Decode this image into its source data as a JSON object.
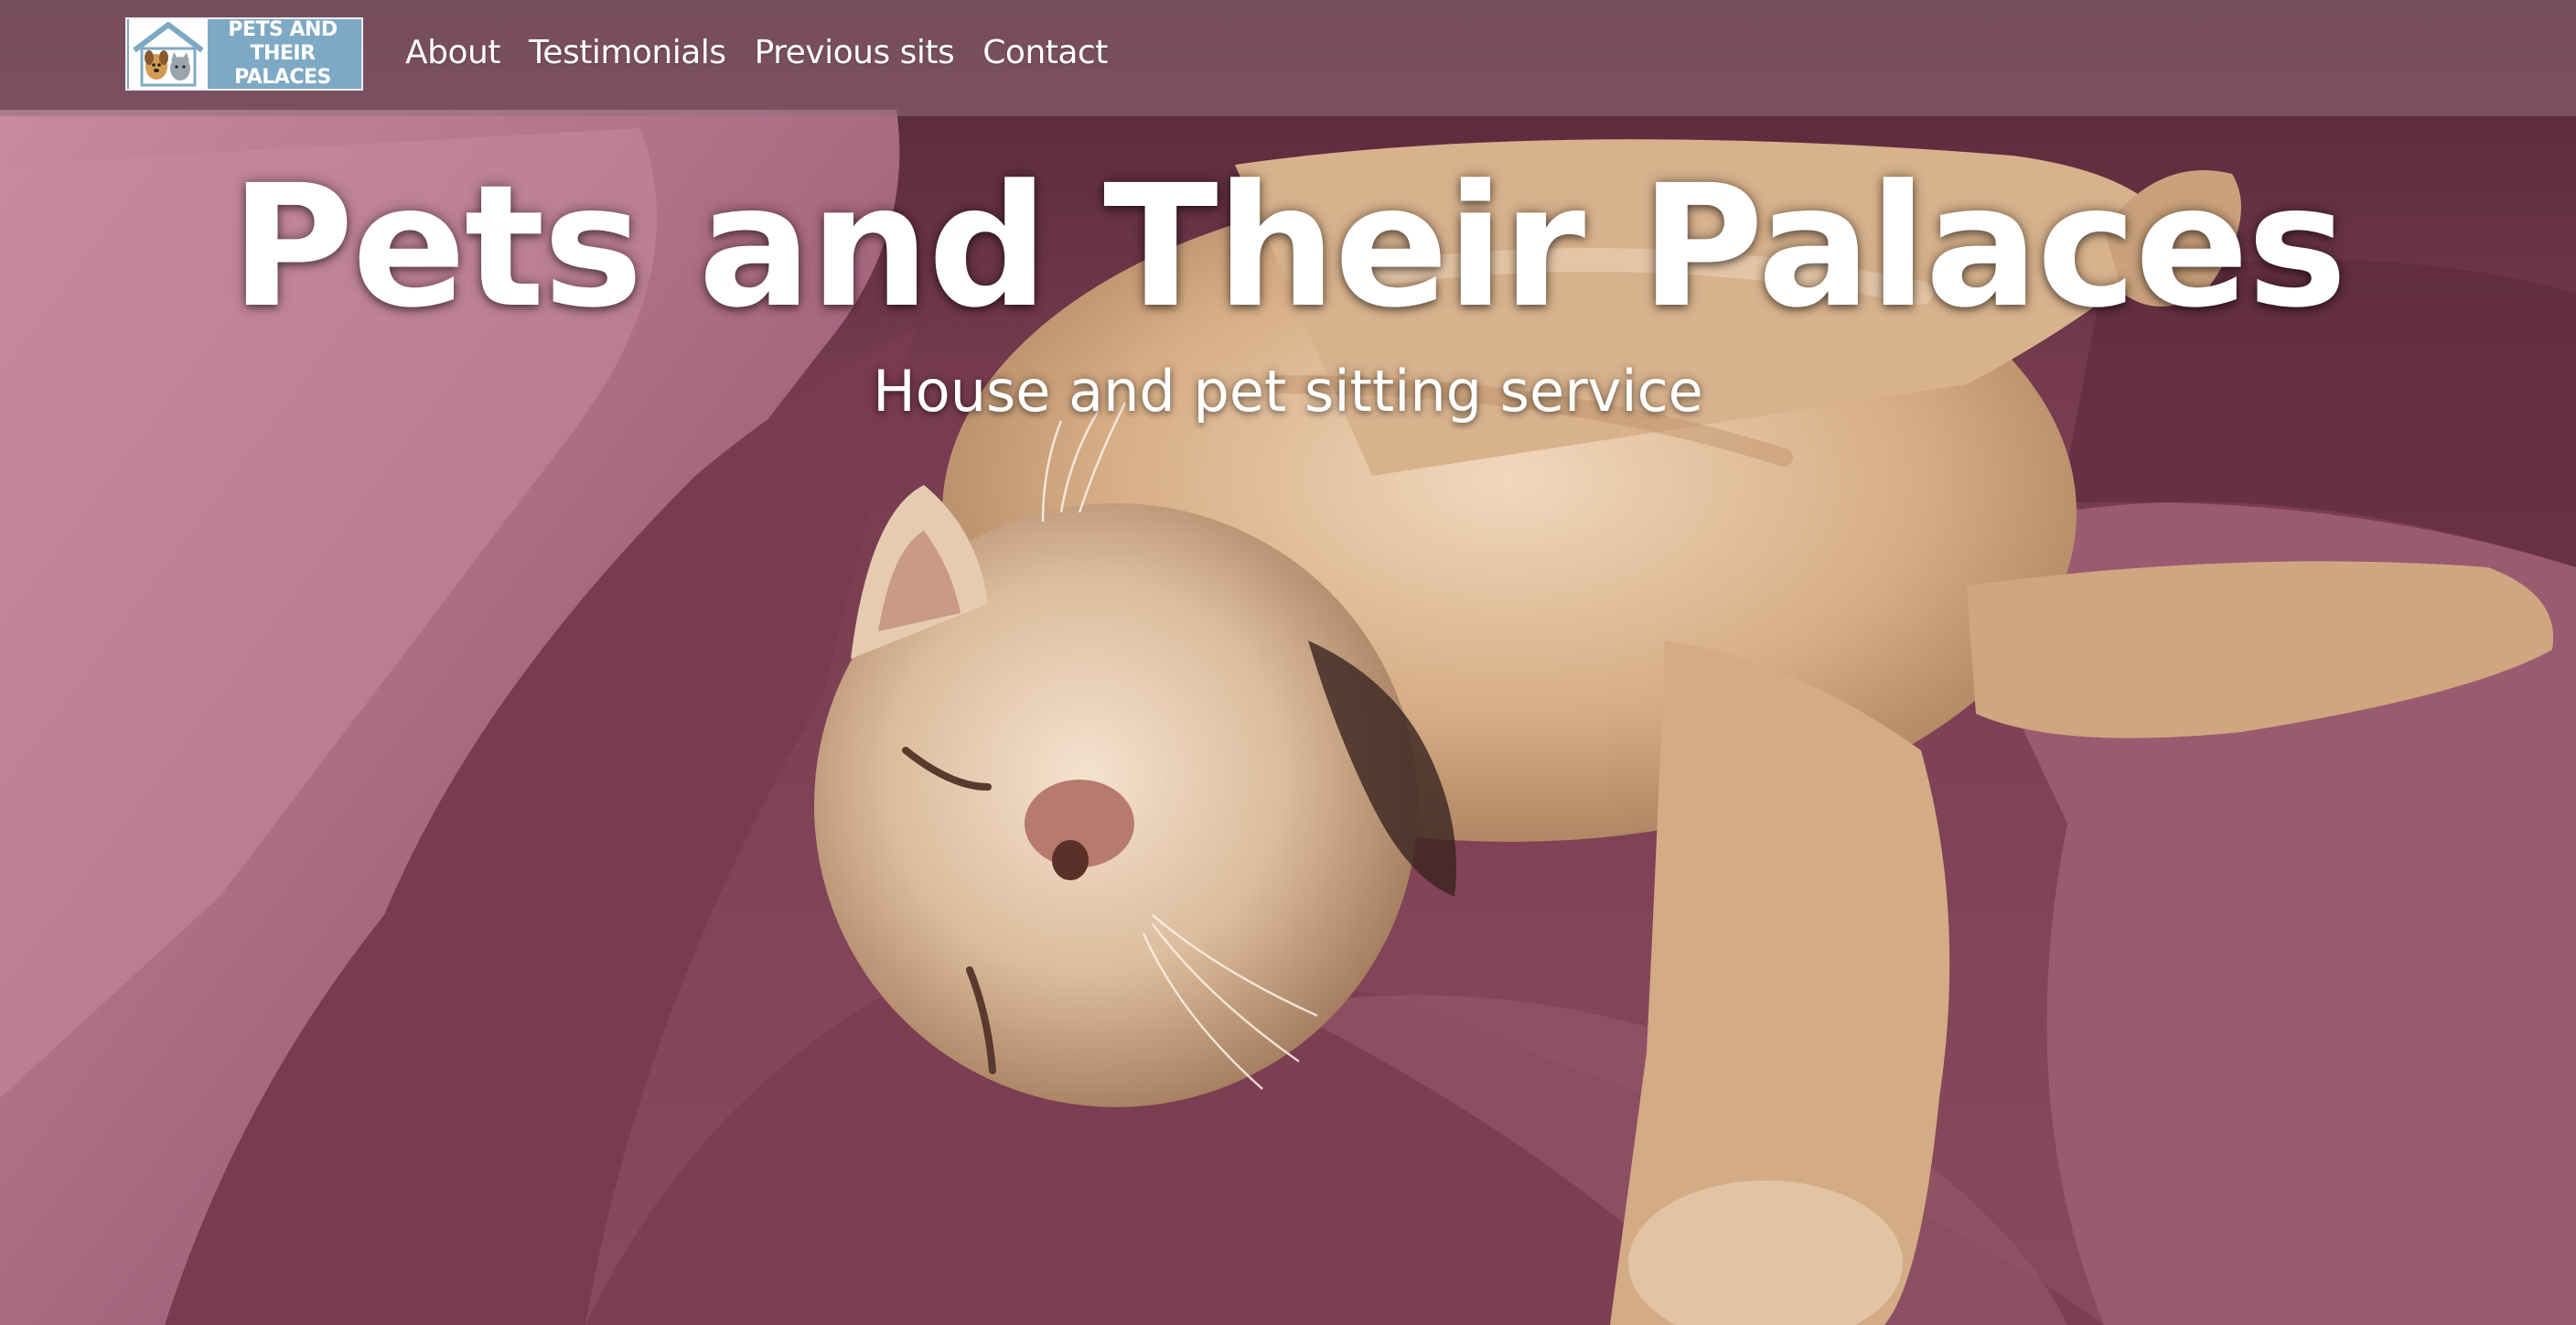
{
  "logo": {
    "text_line1": "PETS AND THEIR",
    "text_line2": "PALACES",
    "icon": "house-with-dog-and-cat-icon"
  },
  "nav": {
    "items": [
      {
        "label": "About"
      },
      {
        "label": "Testimonials"
      },
      {
        "label": "Previous sits"
      },
      {
        "label": "Contact"
      }
    ]
  },
  "hero": {
    "title": "Pets and Their Palaces",
    "subtitle": "House and pet sitting service",
    "image": "sleeping-cat-on-bed-photo"
  },
  "colors": {
    "navbar_bg": "#966e7d",
    "logo_bg": "#7ea9c4",
    "text": "#ffffff",
    "blanket": "#7a3f52",
    "cat_fur": "#d9b48f"
  }
}
